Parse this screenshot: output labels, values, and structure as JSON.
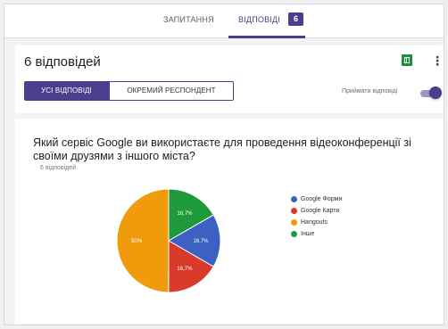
{
  "tabs": {
    "questions_label": "ЗАПИТАННЯ",
    "responses_label": "ВІДПОВІДІ",
    "responses_count": "6"
  },
  "summary": {
    "title": "6 відповідей",
    "sheets_icon": "google-sheets-icon",
    "more_icon": "more-vert-icon",
    "view_all_label": "УСІ ВІДПОВІДІ",
    "view_single_label": "ОКРЕМИЙ РЕСПОНДЕНТ",
    "accepting_label": "Приймати відповіді",
    "accepting_enabled": true
  },
  "question": {
    "title": "Який сервіс Google ви використаєте для проведення відеоконференції зі своїми друзями з іншого міста?",
    "response_count": "6 відповідей"
  },
  "colors": {
    "accent": "#4a3f8f",
    "blue": "#3c61c2",
    "red": "#da3a2a",
    "orange": "#ef9b0c",
    "green": "#1e9a3c"
  },
  "chart_data": {
    "type": "pie",
    "labels": [
      "Google Форми",
      "Google Карти",
      "Hangouts",
      "Інше"
    ],
    "values": [
      16.7,
      16.7,
      50,
      16.7
    ],
    "value_labels": [
      "16,7%",
      "16,7%",
      "50%",
      "16,7%"
    ],
    "colors": [
      "#3c61c2",
      "#da3a2a",
      "#ef9b0c",
      "#1e9a3c"
    ],
    "legend_position": "right"
  }
}
